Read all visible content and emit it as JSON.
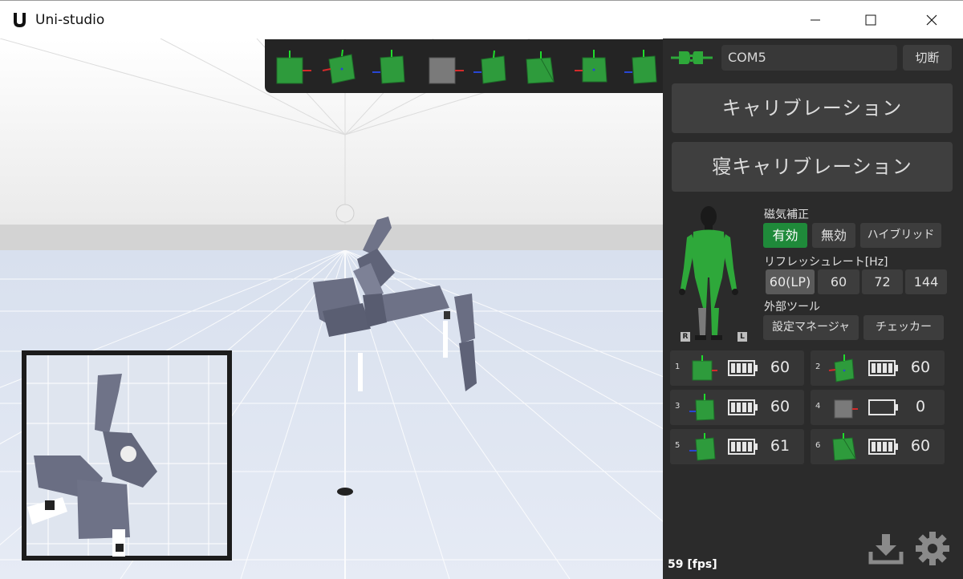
{
  "app": {
    "title": "Uni-studio"
  },
  "connection": {
    "port": "COM5",
    "disconnect_label": "切断"
  },
  "buttons": {
    "calibration": "キャリブレーション",
    "lying_calibration": "寝キャリブレーション"
  },
  "magnetic": {
    "label": "磁気補正",
    "options": [
      "有効",
      "無効",
      "ハイブリッド"
    ],
    "selected": "有効"
  },
  "refresh": {
    "label": "リフレッシュレート[Hz]",
    "options": [
      "60(LP)",
      "60",
      "72",
      "144"
    ],
    "selected": "60(LP)"
  },
  "external_tools": {
    "label": "外部ツール",
    "settings_manager": "設定マネージャ",
    "checker": "チェッカー"
  },
  "avatar": {
    "right": "R",
    "left": "L"
  },
  "sensors": [
    {
      "index": "1",
      "rate": "60",
      "battery": 0.8,
      "status": "active"
    },
    {
      "index": "2",
      "rate": "60",
      "battery": 0.8,
      "status": "active"
    },
    {
      "index": "3",
      "rate": "60",
      "battery": 0.8,
      "status": "active"
    },
    {
      "index": "4",
      "rate": "0",
      "battery": 0,
      "status": "inactive"
    },
    {
      "index": "5",
      "rate": "61",
      "battery": 0.8,
      "status": "active"
    },
    {
      "index": "6",
      "rate": "60",
      "battery": 0.8,
      "status": "active"
    }
  ],
  "status": {
    "fps": "59 [fps]"
  },
  "icons": {
    "connection": "plug-connected-icon",
    "download": "download-icon",
    "settings": "gear-icon"
  },
  "colors": {
    "accent_green": "#1f8a3a",
    "sensor_green": "#2e9b3c",
    "panel_bg": "#2b2b2b",
    "inactive_gray": "#7a7a7a"
  }
}
